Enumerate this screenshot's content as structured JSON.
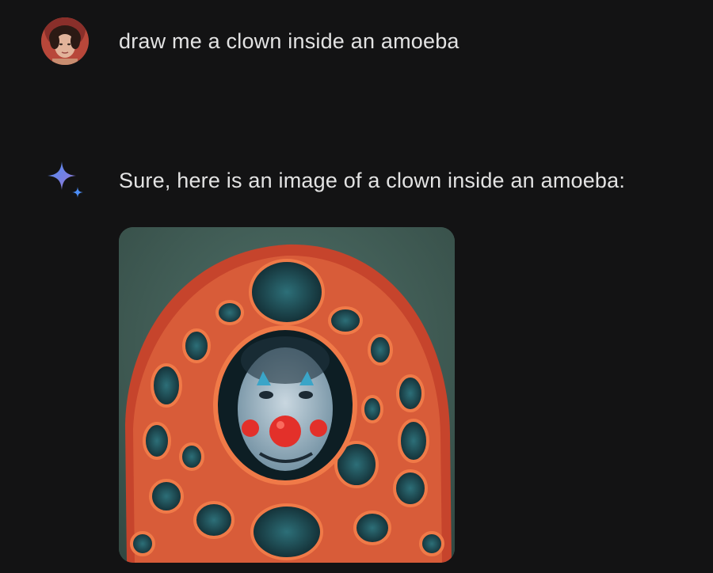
{
  "user_message": {
    "avatar": "user-avatar",
    "text": "draw me a clown inside an amoeba"
  },
  "assistant_message": {
    "icon": "sparkle-icon",
    "text": "Sure, here is an image of a clown inside an amoeba:",
    "image": "clown-inside-amoeba-image"
  },
  "colors": {
    "background": "#131314",
    "text": "#e3e3e3",
    "sparkle_blue": "#4c8df6",
    "sparkle_purple": "#9b72cb"
  }
}
